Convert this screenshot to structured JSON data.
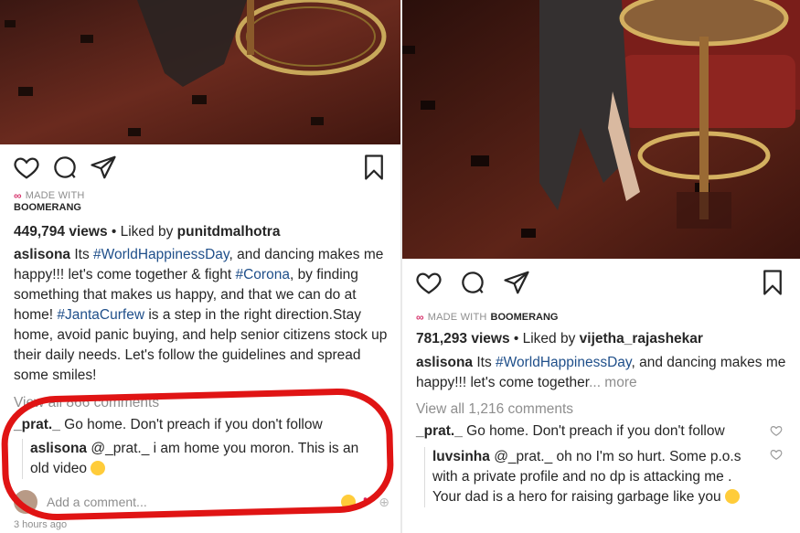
{
  "left": {
    "made_with": "MADE WITH",
    "boomerang": "BOOMERANG",
    "views": "449,794 views",
    "liked_prefix": " • Liked by ",
    "liked_by": "punitdmalhotra",
    "author": "aslisona",
    "caption_1": " Its ",
    "caption_tag1": "#WorldHappinessDay",
    "caption_2": ", and dancing makes me happy!!! let's come together & fight ",
    "caption_tag2": "#Corona",
    "caption_3": ", by finding something that makes us happy, and that we can do at home! ",
    "caption_tag3": "#JantaCurfew",
    "caption_4": " is a step in the right direction.Stay home, avoid panic buying, and help senior citizens stock up their daily needs. Let's follow the guidelines and spread some smiles!",
    "view_all": "View all 866 comments",
    "comment_user": "_prat._",
    "comment_text": " Go home. Don't preach if you don't follow",
    "reply_user": "aslisona",
    "reply_text": " @_prat._ i am home you moron. This is an old video",
    "add_comment": "Add a comment...",
    "time": "3 hours ago"
  },
  "right": {
    "made_with": "MADE WITH",
    "boomerang": "BOOMERANG",
    "views": "781,293 views",
    "liked_prefix": " • Liked by ",
    "liked_by": "vijetha_rajashekar",
    "author": "aslisona",
    "caption_1": " Its ",
    "caption_tag1": "#WorldHappinessDay",
    "caption_2": ", and dancing makes me happy!!! let's come together",
    "more": "... more",
    "view_all": "View all 1,216 comments",
    "comment_user": "_prat._",
    "comment_text": " Go home. Don't preach if you don't follow",
    "reply_user": "luvsinha",
    "reply_text": " @_prat._ oh no I'm so hurt. Some p.o.s with a private profile and no dp is attacking me . Your dad is a hero for raising garbage like you"
  },
  "colors": {
    "highlight_ring": "#e01414",
    "hashtag": "#1f4f8a",
    "muted": "#8e8e8e"
  },
  "icons": [
    "heart-icon",
    "comment-icon",
    "share-icon",
    "bookmark-icon",
    "infinity-icon",
    "small-heart-icon",
    "emoji-icon"
  ]
}
